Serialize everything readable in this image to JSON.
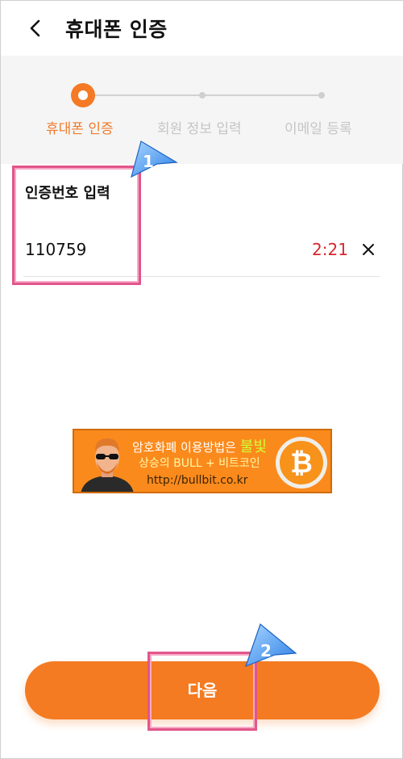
{
  "header": {
    "title": "휴대폰 인증",
    "back_icon": "chevron-left-icon"
  },
  "stepper": {
    "steps": [
      {
        "label": "휴대폰 인증",
        "state": "active"
      },
      {
        "label": "회원 정보 입력",
        "state": "inactive"
      },
      {
        "label": "이메일 등록",
        "state": "inactive"
      }
    ]
  },
  "form": {
    "label": "인증번호 입력",
    "code_value": "110759",
    "timer": "2:21",
    "clear_icon": "close-icon"
  },
  "ad": {
    "line1_prefix": "암호화폐 이용방법은",
    "line1_highlight": "불빛",
    "line2": "상승의 BULL + 비트코인",
    "line3": "http://bullbit.co.kr",
    "coin_symbol": "₿"
  },
  "next_button": {
    "label": "다음"
  },
  "annotations": {
    "marker1": "1",
    "marker2": "2"
  },
  "colors": {
    "accent": "#f47b22",
    "timer": "#d8262c",
    "highlight_box": "#e2568a"
  }
}
